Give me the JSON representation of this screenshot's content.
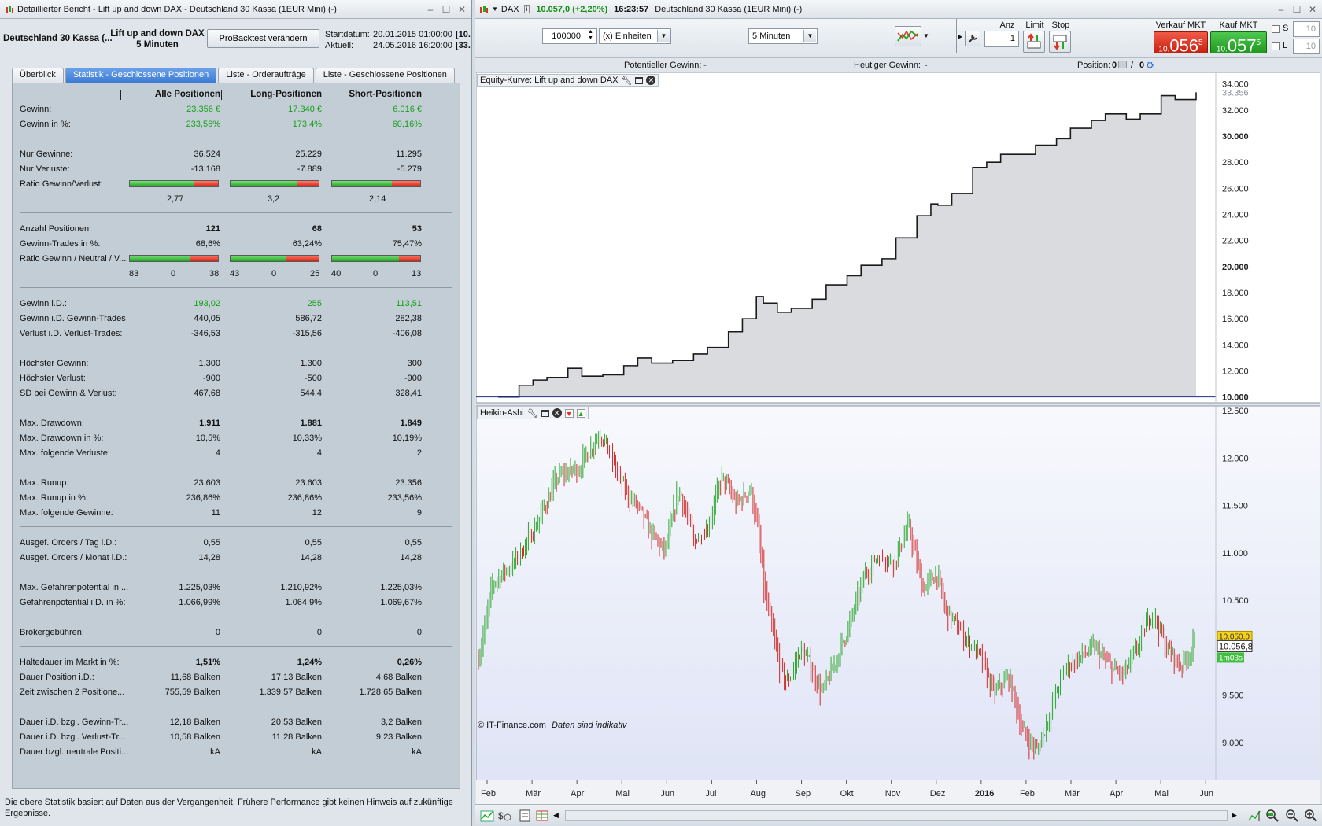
{
  "left_window": {
    "title": "Detaillierter Bericht - Lift up and down DAX - Deutschland 30 Kassa (1EUR Mini) (-)",
    "instrument": "Deutschland 30 Kassa (...",
    "strategy_line1": "Lift up and down DAX",
    "strategy_line2": "5 Minuten",
    "modify_button": "ProBacktest verändern",
    "start_label": "Startdatum:",
    "start_value": "20.01.2015 01:00:00",
    "start_extra": "[10.",
    "current_label": "Aktuell:",
    "current_value": "24.05.2016 16:20:00",
    "current_extra": "[33.",
    "tabs": [
      {
        "label": "Überblick",
        "active": false
      },
      {
        "label": "Statistik - Geschlossene Positionen",
        "active": true
      },
      {
        "label": "Liste - Orderaufträge",
        "active": false
      },
      {
        "label": "Liste - Geschlossene Positionen",
        "active": false
      }
    ],
    "columns": [
      "Alle Positionen",
      "Long-Positionen",
      "Short-Positionen"
    ],
    "stats": [
      {
        "label": "Gewinn:",
        "values": [
          "23.356 €",
          "17.340 €",
          "6.016 €"
        ],
        "style": "green"
      },
      {
        "label": "Gewinn in %:",
        "values": [
          "233,56%",
          "173,4%",
          "60,16%"
        ],
        "style": "green"
      },
      {
        "divider": true
      },
      {
        "label": "Nur Gewinne:",
        "values": [
          "36.524",
          "25.229",
          "11.295"
        ]
      },
      {
        "label": "Nur Verluste:",
        "values": [
          "-13.168",
          "-7.889",
          "-5.279"
        ]
      },
      {
        "label": "Ratio Gewinn/Verlust:",
        "bars": [
          0.735,
          0.762,
          0.68
        ]
      },
      {
        "label": "",
        "centered": [
          "2,77",
          "3,2",
          "2,14"
        ]
      },
      {
        "divider": true
      },
      {
        "label": "Anzahl Positionen:",
        "values": [
          "121",
          "68",
          "53"
        ],
        "style": "bold"
      },
      {
        "label": "Gewinn-Trades in %:",
        "values": [
          "68,6%",
          "63,24%",
          "75,47%"
        ]
      },
      {
        "label": "Ratio Gewinn / Neutral / V...",
        "bars": [
          0.686,
          0.632,
          0.755
        ]
      },
      {
        "label": "",
        "triples": [
          [
            "83",
            "0",
            "38"
          ],
          [
            "43",
            "0",
            "25"
          ],
          [
            "40",
            "0",
            "13"
          ]
        ]
      },
      {
        "divider": true
      },
      {
        "label": "Gewinn i.D.:",
        "values": [
          "193,02",
          "255",
          "113,51"
        ],
        "style": "green"
      },
      {
        "label": "Gewinn i.D. Gewinn-Trades",
        "values": [
          "440,05",
          "586,72",
          "282,38"
        ]
      },
      {
        "label": "Verlust i.D. Verlust-Trades:",
        "values": [
          "-346,53",
          "-315,56",
          "-406,08"
        ]
      },
      {
        "gap": true
      },
      {
        "label": "Höchster Gewinn:",
        "values": [
          "1.300",
          "1.300",
          "300"
        ]
      },
      {
        "label": "Höchster Verlust:",
        "values": [
          "-900",
          "-500",
          "-900"
        ]
      },
      {
        "label": "SD bei Gewinn & Verlust:",
        "values": [
          "467,68",
          "544,4",
          "328,41"
        ]
      },
      {
        "gap": true
      },
      {
        "label": "Max. Drawdown:",
        "values": [
          "1.911",
          "1.881",
          "1.849"
        ],
        "style": "bold"
      },
      {
        "label": "Max. Drawdown in %:",
        "values": [
          "10,5%",
          "10,33%",
          "10,19%"
        ]
      },
      {
        "label": "Max. folgende Verluste:",
        "values": [
          "4",
          "4",
          "2"
        ]
      },
      {
        "gap": true
      },
      {
        "label": "Max. Runup:",
        "values": [
          "23.603",
          "23.603",
          "23.356"
        ]
      },
      {
        "label": "Max. Runup in %:",
        "values": [
          "236,86%",
          "236,86%",
          "233,56%"
        ]
      },
      {
        "label": "Max. folgende Gewinne:",
        "values": [
          "11",
          "12",
          "9"
        ]
      },
      {
        "divider": true
      },
      {
        "label": "Ausgef. Orders / Tag i.D.:",
        "values": [
          "0,55",
          "0,55",
          "0,55"
        ]
      },
      {
        "label": "Ausgef. Orders / Monat i.D.:",
        "values": [
          "14,28",
          "14,28",
          "14,28"
        ]
      },
      {
        "gap": true
      },
      {
        "label": "Max. Gefahrenpotential in ...",
        "values": [
          "1.225,03%",
          "1.210,92%",
          "1.225,03%"
        ]
      },
      {
        "label": "Gefahrenpotential i.D. in %:",
        "values": [
          "1.066,99%",
          "1.064,9%",
          "1.069,67%"
        ]
      },
      {
        "gap": true
      },
      {
        "label": "Brokergebühren:",
        "values": [
          "0",
          "0",
          "0"
        ]
      },
      {
        "divider": true
      },
      {
        "label": "Haltedauer im Markt in %:",
        "values": [
          "1,51%",
          "1,24%",
          "0,26%"
        ],
        "style": "bold"
      },
      {
        "label": "Dauer Position i.D.:",
        "values": [
          "11,68 Balken",
          "17,13 Balken",
          "4,68 Balken"
        ]
      },
      {
        "label": "Zeit zwischen 2 Positione...",
        "values": [
          "755,59 Balken",
          "1.339,57 Balken",
          "1.728,65 Balken"
        ]
      },
      {
        "gap": true
      },
      {
        "label": "Dauer i.D. bzgl. Gewinn-Tr...",
        "values": [
          "12,18 Balken",
          "20,53 Balken",
          "3,2 Balken"
        ]
      },
      {
        "label": "Dauer i.D. bzgl. Verlust-Tr...",
        "values": [
          "10,58 Balken",
          "11,28 Balken",
          "9,23 Balken"
        ]
      },
      {
        "label": "Dauer bzgl. neutrale Positi...",
        "values": [
          "kA",
          "kA",
          "kA"
        ]
      }
    ],
    "disclaimer": "Die obere Statistik basiert auf Daten aus der Vergangenheit. Frühere Performance gibt keinen Hinweis auf zukünftige Ergebnisse."
  },
  "right_window": {
    "ticker": "DAX",
    "quote": "10.057,0 (+2,20%)",
    "time": "16:23:57",
    "instrument": "Deutschland 30 Kassa (1EUR Mini) (-)",
    "quantity": "100000",
    "unit": "(x) Einheiten",
    "timeframe": "5 Minuten",
    "anz_label": "Anz",
    "anz_value": "1",
    "limit_label": "Limit",
    "stop_label": "Stop",
    "sell_label": "Verkauf MKT",
    "sell_prefix": "10.",
    "sell_main": "056",
    "sell_sup": "5",
    "buy_label": "Kauf MKT",
    "buy_prefix": "10.",
    "buy_main": "057",
    "buy_sup": "5",
    "s_label": "S",
    "s_value": "10",
    "l_label": "L",
    "l_value": "10",
    "potential_label": "Potentieller Gewinn:",
    "potential_value": "-",
    "today_label": "Heutiger Gewinn:",
    "today_value": "-",
    "position_label": "Position:",
    "position_value1": "0",
    "position_sep": "/",
    "position_value2": "0",
    "copyright": "© IT-Finance.com",
    "copyright_note": "Daten sind indikativ",
    "colors": {
      "up": "#2fa82f",
      "down": "#d42a2a",
      "equity_line": "#1a1a1a"
    }
  },
  "chart_data": [
    {
      "type": "area",
      "title": "Equity-Kurve: Lift up and down DAX",
      "y_axis_labels": [
        "34.000",
        "32.000",
        "30.000",
        "28.000",
        "26.000",
        "24.000",
        "22.000",
        "20.000",
        "18.000",
        "16.000",
        "14.000",
        "12.000",
        "10.000"
      ],
      "ylim": [
        9800,
        34400
      ],
      "baseline": 10000,
      "baseline_label": "10.000",
      "current_label": "33.356",
      "x": [
        0,
        0.03,
        0.05,
        0.07,
        0.1,
        0.12,
        0.15,
        0.18,
        0.2,
        0.22,
        0.25,
        0.28,
        0.3,
        0.33,
        0.35,
        0.37,
        0.38,
        0.4,
        0.42,
        0.45,
        0.47,
        0.5,
        0.52,
        0.55,
        0.57,
        0.6,
        0.62,
        0.63,
        0.65,
        0.68,
        0.7,
        0.72,
        0.74,
        0.77,
        0.8,
        0.82,
        0.85,
        0.87,
        0.9,
        0.92,
        0.95,
        0.97,
        1.0
      ],
      "values": [
        10000,
        10900,
        11300,
        11500,
        12200,
        11600,
        11700,
        12400,
        13000,
        12600,
        12800,
        13300,
        13800,
        15000,
        16000,
        17700,
        17200,
        16500,
        16800,
        17500,
        18600,
        19300,
        20100,
        20600,
        22200,
        23900,
        24800,
        24700,
        25600,
        27600,
        28000,
        28600,
        28600,
        29300,
        29800,
        30600,
        31200,
        31700,
        31300,
        31700,
        33100,
        32800,
        33356
      ]
    },
    {
      "type": "heikin-ashi",
      "title": "Heikin-Ashi",
      "y_axis_labels": [
        "12.500",
        "12.000",
        "11.500",
        "11.000",
        "10.500",
        "10.000",
        "9.500",
        "9.000"
      ],
      "ylim": [
        8600,
        12550
      ],
      "x_labels": [
        "Feb",
        "Mär",
        "Apr",
        "Mai",
        "Jun",
        "Jul",
        "Aug",
        "Sep",
        "Okt",
        "Nov",
        "Dez",
        "2016",
        "Feb",
        "Mär",
        "Apr",
        "Mai",
        "Jun"
      ],
      "current_label": "10.056,8",
      "current_label_2": "10.050,0",
      "countdown": "1m03s",
      "path_x": [
        0,
        0.02,
        0.05,
        0.08,
        0.11,
        0.14,
        0.17,
        0.19,
        0.2,
        0.22,
        0.24,
        0.26,
        0.28,
        0.3,
        0.32,
        0.34,
        0.36,
        0.38,
        0.39,
        0.4,
        0.42,
        0.43,
        0.45,
        0.47,
        0.48,
        0.5,
        0.52,
        0.54,
        0.56,
        0.58,
        0.6,
        0.62,
        0.64,
        0.65,
        0.67,
        0.7,
        0.72,
        0.74,
        0.76,
        0.78,
        0.8,
        0.82,
        0.84,
        0.86,
        0.88,
        0.9,
        0.92,
        0.94,
        0.96,
        0.98,
        1.0
      ],
      "path_values": [
        9900,
        10700,
        10900,
        11300,
        11800,
        11900,
        12300,
        11900,
        11700,
        11500,
        11200,
        11000,
        11700,
        11100,
        11300,
        11800,
        11500,
        11700,
        11200,
        10500,
        9800,
        9600,
        10000,
        9700,
        9500,
        9900,
        10300,
        10800,
        11000,
        10900,
        11300,
        10600,
        10800,
        10400,
        10200,
        9900,
        9500,
        9700,
        9100,
        8900,
        9400,
        9800,
        9900,
        10000,
        9800,
        9700,
        10000,
        10400,
        10000,
        9800,
        10057
      ]
    }
  ]
}
